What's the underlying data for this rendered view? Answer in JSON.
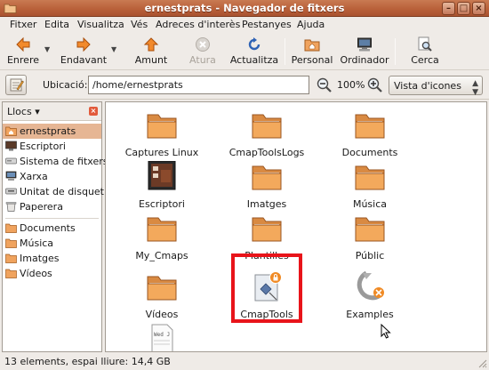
{
  "window": {
    "title": "ernestprats - Navegador de fitxers"
  },
  "menu": [
    "Fitxer",
    "Edita",
    "Visualitza",
    "Vés",
    "Adreces d'interès",
    "Pestanyes",
    "Ajuda"
  ],
  "toolbar": {
    "back": "Enrere",
    "forward": "Endavant",
    "up": "Amunt",
    "stop": "Atura",
    "reload": "Actualitza",
    "home": "Personal",
    "computer": "Ordinador",
    "search": "Cerca"
  },
  "location": {
    "label": "Ubicació:",
    "path": "/home/ernestprats",
    "zoom": "100%",
    "view_mode": "Vista d'icones"
  },
  "sidebar": {
    "title": "Llocs",
    "items": [
      {
        "label": "ernestprats",
        "icon": "home-folder-icon",
        "selected": true
      },
      {
        "label": "Escriptori",
        "icon": "desktop-icon"
      },
      {
        "label": "Sistema de fitxers",
        "icon": "drive-icon"
      },
      {
        "label": "Xarxa",
        "icon": "network-icon"
      },
      {
        "label": "Unitat de disquet",
        "icon": "floppy-icon"
      },
      {
        "label": "Paperera",
        "icon": "trash-icon"
      },
      {
        "label": "Documents",
        "icon": "folder-icon"
      },
      {
        "label": "Música",
        "icon": "folder-icon"
      },
      {
        "label": "Imatges",
        "icon": "folder-icon"
      },
      {
        "label": "Vídeos",
        "icon": "folder-icon"
      }
    ]
  },
  "files": [
    {
      "label": "Captures Linux",
      "icon": "folder-icon"
    },
    {
      "label": "CmapToolsLogs",
      "icon": "folder-icon"
    },
    {
      "label": "Documents",
      "icon": "folder-icon"
    },
    {
      "label": "Escriptori",
      "icon": "desktop-folder-icon"
    },
    {
      "label": "Imatges",
      "icon": "folder-icon"
    },
    {
      "label": "Música",
      "icon": "folder-icon"
    },
    {
      "label": "My_Cmaps",
      "icon": "folder-icon"
    },
    {
      "label": "Plantilles",
      "icon": "folder-icon"
    },
    {
      "label": "Públic",
      "icon": "folder-icon"
    },
    {
      "label": "Vídeos",
      "icon": "folder-icon"
    },
    {
      "label": "CmapTools",
      "icon": "cmaptools-launcher-icon",
      "highlighted": true
    },
    {
      "label": "Examples",
      "icon": "symlink-icon"
    },
    {
      "label": "",
      "icon": "text-document-icon",
      "preview_text": "Wed J"
    }
  ],
  "status": {
    "text": "13 elements, espai lliure: 14,4 GB"
  },
  "colors": {
    "titlebar": "#b9613a",
    "selection": "#e6b694",
    "folder": "#f0a35e",
    "highlight_box": "#e8141a"
  }
}
